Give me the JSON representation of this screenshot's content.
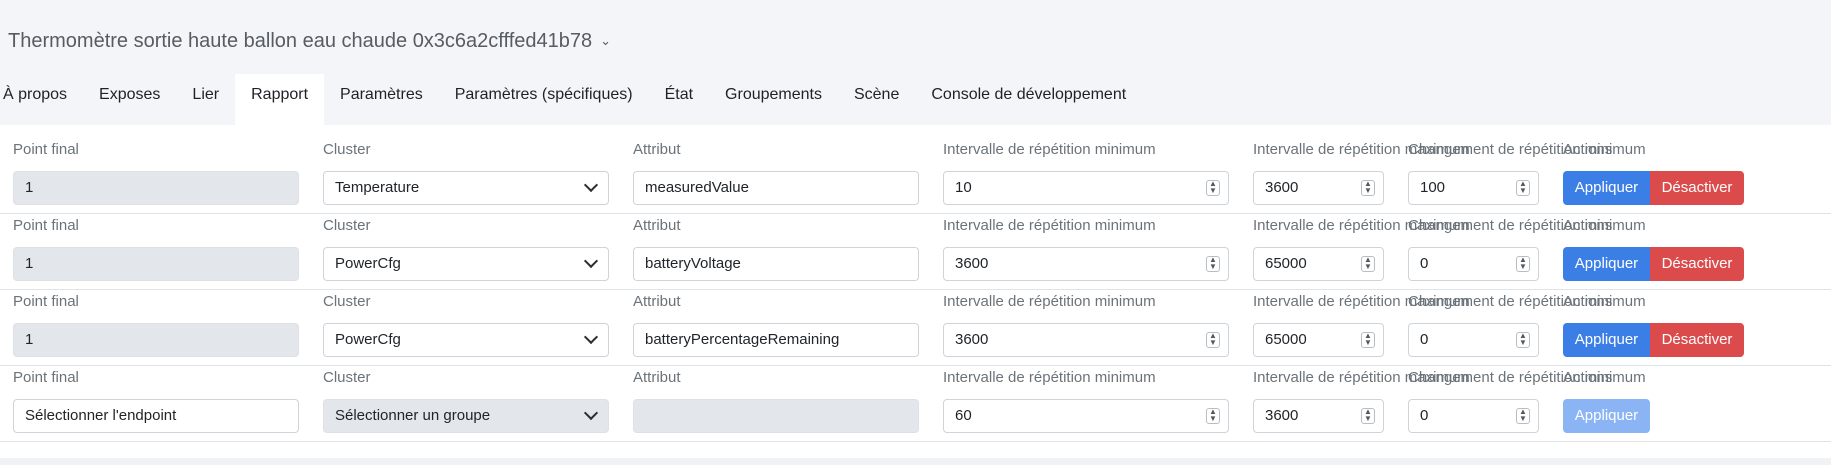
{
  "device": {
    "title": "Thermomètre sortie haute ballon eau chaude 0x3c6a2cfffed41b78",
    "chevron_icon": "chevron-down-icon"
  },
  "tabs": [
    {
      "label": "À propos"
    },
    {
      "label": "Exposes"
    },
    {
      "label": "Lier"
    },
    {
      "label": "Rapport"
    },
    {
      "label": "Paramètres"
    },
    {
      "label": "Paramètres (spécifiques)"
    },
    {
      "label": "État"
    },
    {
      "label": "Groupements"
    },
    {
      "label": "Scène"
    },
    {
      "label": "Console de développement"
    }
  ],
  "active_tab": "Rapport",
  "labels": {
    "endpoint": "Point final",
    "cluster": "Cluster",
    "attribute": "Attribut",
    "min_interval": "Intervalle de répétition minimum",
    "max_interval": "Intervalle de répétition maximum",
    "change": "Changement de répétition minimum",
    "actions": "Actions"
  },
  "buttons": {
    "apply": "Appliquer",
    "disable": "Désactiver"
  },
  "rows": [
    {
      "endpoint": "1",
      "cluster": "Temperature",
      "attribute": "measuredValue",
      "min": "10",
      "max": "3600",
      "change": "100"
    },
    {
      "endpoint": "1",
      "cluster": "PowerCfg",
      "attribute": "batteryVoltage",
      "min": "3600",
      "max": "65000",
      "change": "0"
    },
    {
      "endpoint": "1",
      "cluster": "PowerCfg",
      "attribute": "batteryPercentageRemaining",
      "min": "3600",
      "max": "65000",
      "change": "0"
    },
    {
      "endpoint": "Sélectionner l'endpoint",
      "cluster": "Sélectionner un groupe",
      "attribute": "",
      "min": "60",
      "max": "3600",
      "change": "0"
    }
  ],
  "colors": {
    "apply": "#3b7fe6",
    "disable": "#dc4b4b",
    "apply_disabled": "#8ab4f3"
  }
}
